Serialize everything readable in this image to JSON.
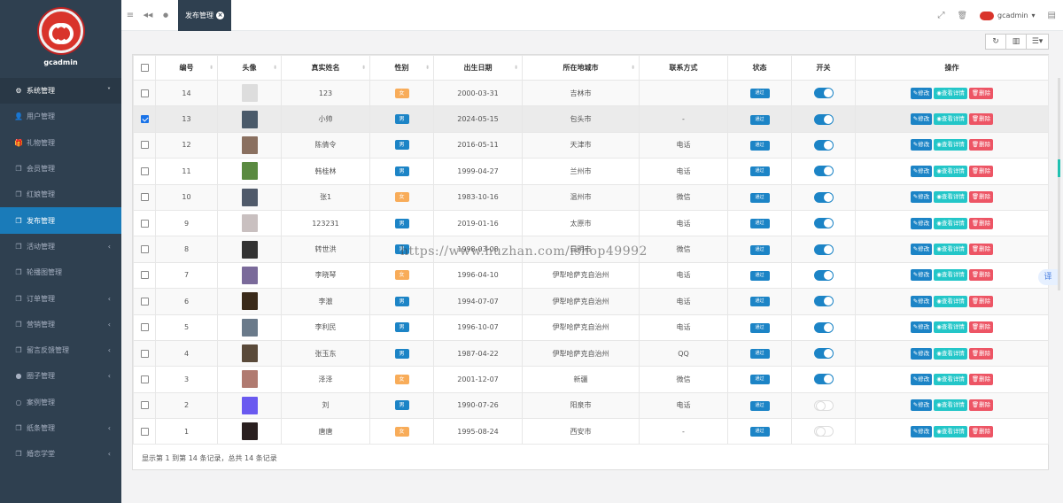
{
  "sidebar": {
    "brand": "gcadmin",
    "items": [
      {
        "label": "系统管理",
        "icon": "gears-icon",
        "glyph": "⚙",
        "open": true,
        "arrow": "˅"
      },
      {
        "label": "用户管理",
        "icon": "user-icon",
        "glyph": "👤"
      },
      {
        "label": "礼物管理",
        "icon": "gift-icon",
        "glyph": "🎁"
      },
      {
        "label": "会员管理",
        "icon": "copy-icon",
        "glyph": "❐"
      },
      {
        "label": "红娘管理",
        "icon": "copy-icon",
        "glyph": "❐"
      },
      {
        "label": "发布管理",
        "icon": "copy-icon",
        "glyph": "❐",
        "active": true
      },
      {
        "label": "活动管理",
        "icon": "copy-icon",
        "glyph": "❐",
        "arrow": "‹"
      },
      {
        "label": "轮播图管理",
        "icon": "copy-icon",
        "glyph": "❐"
      },
      {
        "label": "订单管理",
        "icon": "copy-icon",
        "glyph": "❐",
        "arrow": "‹"
      },
      {
        "label": "营销管理",
        "icon": "copy-icon",
        "glyph": "❐",
        "arrow": "‹"
      },
      {
        "label": "留言反馈管理",
        "icon": "copy-icon",
        "glyph": "❐",
        "arrow": "‹"
      },
      {
        "label": "圈子管理",
        "icon": "globe-icon",
        "glyph": "●",
        "arrow": "‹"
      },
      {
        "label": "案例管理",
        "icon": "circle-icon",
        "glyph": "○"
      },
      {
        "label": "纸条管理",
        "icon": "copy-icon",
        "glyph": "❐",
        "arrow": "‹"
      },
      {
        "label": "婚恋学堂",
        "icon": "copy-icon",
        "glyph": "❐",
        "arrow": "‹"
      }
    ]
  },
  "topbar": {
    "tab_label": "发布管理",
    "tab_close": "×",
    "user_name": "gcadmin",
    "user_caret": "▾",
    "menu_glyph": "≡",
    "back_glyph": "◀◀",
    "refresh_glyph": "●",
    "fullscreen_glyph": "⤢",
    "trash_glyph": "🗑",
    "more_glyph": "▤"
  },
  "toolbar": {
    "refresh_glyph": "↻",
    "columns_glyph": "▥",
    "list_glyph": "☰▾"
  },
  "table": {
    "headers": [
      "编号",
      "头像",
      "真实姓名",
      "性别",
      "出生日期",
      "所在地城市",
      "联系方式",
      "状态",
      "开关",
      "操作"
    ],
    "sortable": [
      true,
      true,
      true,
      true,
      true,
      true,
      false,
      false,
      false,
      false
    ],
    "sort_glyph": "⬍",
    "rows": [
      {
        "id": "14",
        "avatar": "#ddd",
        "name": "123",
        "sex": "女",
        "birth": "2000-03-31",
        "city": "吉林市",
        "contact": "",
        "status": "通过",
        "on": true,
        "checked": false
      },
      {
        "id": "13",
        "avatar": "#4a5a6a",
        "name": "小帅",
        "sex": "男",
        "birth": "2024-05-15",
        "city": "包头市",
        "contact": "-",
        "status": "通过",
        "on": true,
        "checked": true
      },
      {
        "id": "12",
        "avatar": "#8a7060",
        "name": "陈倩令",
        "sex": "男",
        "birth": "2016-05-11",
        "city": "天津市",
        "contact": "电话",
        "status": "通过",
        "on": true,
        "checked": false
      },
      {
        "id": "11",
        "avatar": "#5a8a40",
        "name": "韩桂林",
        "sex": "男",
        "birth": "1999-04-27",
        "city": "兰州市",
        "contact": "电话",
        "status": "通过",
        "on": true,
        "checked": false
      },
      {
        "id": "10",
        "avatar": "#505a6a",
        "name": "张1",
        "sex": "女",
        "birth": "1983-10-16",
        "city": "温州市",
        "contact": "微信",
        "status": "通过",
        "on": true,
        "checked": false
      },
      {
        "id": "9",
        "avatar": "#c9c0c0",
        "name": "123231",
        "sex": "男",
        "birth": "2019-01-16",
        "city": "太原市",
        "contact": "电话",
        "status": "通过",
        "on": true,
        "checked": false
      },
      {
        "id": "8",
        "avatar": "#333",
        "name": "转世洪",
        "sex": "男",
        "birth": "1998-03-08",
        "city": "昆明市",
        "contact": "微信",
        "status": "通过",
        "on": true,
        "checked": false
      },
      {
        "id": "7",
        "avatar": "#7a6a9a",
        "name": "李晓琴",
        "sex": "女",
        "birth": "1996-04-10",
        "city": "伊犁哈萨克自治州",
        "contact": "电话",
        "status": "通过",
        "on": true,
        "checked": false
      },
      {
        "id": "6",
        "avatar": "#3a2a1a",
        "name": "李澈",
        "sex": "男",
        "birth": "1994-07-07",
        "city": "伊犁哈萨克自治州",
        "contact": "电话",
        "status": "通过",
        "on": true,
        "checked": false
      },
      {
        "id": "5",
        "avatar": "#6a7a8a",
        "name": "李利民",
        "sex": "男",
        "birth": "1996-10-07",
        "city": "伊犁哈萨克自治州",
        "contact": "电话",
        "status": "通过",
        "on": true,
        "checked": false
      },
      {
        "id": "4",
        "avatar": "#5a4a3a",
        "name": "张玉东",
        "sex": "男",
        "birth": "1987-04-22",
        "city": "伊犁哈萨克自治州",
        "contact": "QQ",
        "status": "通过",
        "on": true,
        "checked": false
      },
      {
        "id": "3",
        "avatar": "#b07a70",
        "name": "泽泽",
        "sex": "女",
        "birth": "2001-12-07",
        "city": "新疆",
        "contact": "微信",
        "status": "通过",
        "on": true,
        "checked": false
      },
      {
        "id": "2",
        "avatar": "#6a5af0",
        "name": "刘",
        "sex": "男",
        "birth": "1990-07-26",
        "city": "阳泉市",
        "contact": "电话",
        "status": "通过",
        "on": false,
        "checked": false
      },
      {
        "id": "1",
        "avatar": "#2a2020",
        "name": "唐唐",
        "sex": "女",
        "birth": "1995-08-24",
        "city": "西安市",
        "contact": "-",
        "status": "通过",
        "on": false,
        "checked": false
      }
    ],
    "ops": {
      "edit": "✎修改",
      "view": "◉查看详情",
      "del": "🗑删除"
    }
  },
  "pager_info": "显示第 1 到第 14 条记录，总共 14 条记录",
  "watermark": "https://www.huzhan.com/ishop49992",
  "translate_label": "译"
}
